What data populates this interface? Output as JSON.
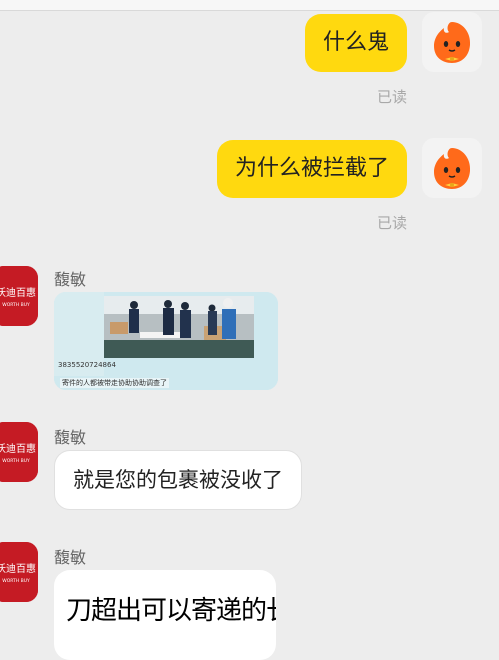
{
  "messages": [
    {
      "id": "m1",
      "direction": "out",
      "text": "什么鬼",
      "status": "已读"
    },
    {
      "id": "m2",
      "direction": "out",
      "text": "为什么被拦截了",
      "status": "已读"
    },
    {
      "id": "m3",
      "direction": "in",
      "sender": "馥敏",
      "type": "image",
      "image_number": "3835520724864",
      "image_caption": "寄件的人都被带走协助协助调查了"
    },
    {
      "id": "m4",
      "direction": "in",
      "sender": "馥敏",
      "text": "就是您的包裹被没收了"
    },
    {
      "id": "m5",
      "direction": "in",
      "sender": "馥敏",
      "type": "sticker",
      "sticker_text": "刀超出可以寄递的长度了"
    }
  ],
  "avatars": {
    "me": {
      "icon": "orange-mascot-icon"
    },
    "them": {
      "icon": "shop-logo-icon",
      "logo_text": "沃迪百惠",
      "logo_subtext": "WORTH BUY"
    }
  },
  "colors": {
    "background": "#ededed",
    "out_bubble": "#ffd90f",
    "in_bubble": "#ffffff",
    "read_status": "#a8a8a8",
    "them_avatar": "#c51b24",
    "me_avatar": "#ff6a1a"
  }
}
